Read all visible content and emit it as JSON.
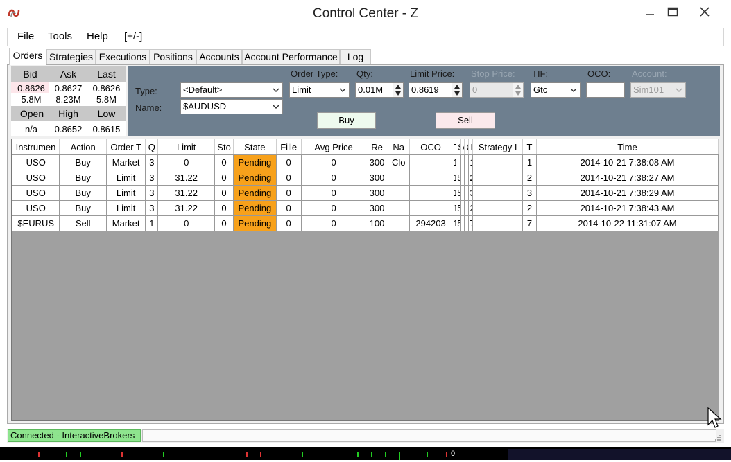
{
  "window": {
    "title": "Control Center - Z"
  },
  "menu": [
    "File",
    "Tools",
    "Help",
    "[+/-]"
  ],
  "tabs": [
    "Orders",
    "Strategies",
    "Executions",
    "Positions",
    "Accounts",
    "Account Performance",
    "Log"
  ],
  "quote": {
    "headers1": [
      "Bid",
      "Ask",
      "Last"
    ],
    "prices": [
      "0.8626",
      "0.8627",
      "0.8626"
    ],
    "sizes": [
      "5.8M",
      "8.23M",
      "5.8M"
    ],
    "headers2": [
      "Open",
      "High",
      "Low"
    ],
    "ohl": [
      "n/a",
      "0.8652",
      "0.8615"
    ]
  },
  "order_entry": {
    "type_label": "Type:",
    "type_value": "<Default>",
    "name_label": "Name:",
    "name_value": "$AUDUSD",
    "order_type_label": "Order Type:",
    "order_type_value": "Limit",
    "qty_label": "Qty:",
    "qty_value": "0.01M",
    "limit_label": "Limit Price:",
    "limit_value": "0.8619",
    "stop_label": "Stop Price:",
    "stop_value": "0",
    "tif_label": "TIF:",
    "tif_value": "Gtc",
    "oco_label": "OCO:",
    "oco_value": "",
    "account_label": "Account:",
    "account_value": "Sim101",
    "buy_label": "Buy",
    "sell_label": "Sell",
    "buy_color": "#eefaee",
    "sell_color": "#fbe9ec"
  },
  "grid": {
    "headers": [
      "Instrumen",
      "Action",
      "Order T",
      "Q",
      "Limit",
      "Sto",
      "State",
      "Fille",
      "Avg Price",
      "Re",
      "Na",
      "OCO",
      "T",
      "S",
      "A",
      "C",
      "I",
      "Strategy I",
      "T",
      "Time"
    ],
    "rows": [
      [
        "USO",
        "Buy",
        "Market",
        "3",
        "0",
        "0",
        "Pending",
        "0",
        "0",
        "300",
        "Clo",
        "",
        "1",
        "",
        "",
        "",
        "1",
        "",
        "1",
        "2014-10-21 7:38:08 AM"
      ],
      [
        "USO",
        "Buy",
        "Limit",
        "3",
        "31.22",
        "0",
        "Pending",
        "0",
        "0",
        "300",
        "",
        "",
        "1",
        "5",
        "",
        "",
        "2",
        "",
        "2",
        "2014-10-21 7:38:27 AM"
      ],
      [
        "USO",
        "Buy",
        "Limit",
        "3",
        "31.22",
        "0",
        "Pending",
        "0",
        "0",
        "300",
        "",
        "",
        "1",
        "5",
        "",
        "",
        "3",
        "",
        "3",
        "2014-10-21 7:38:29 AM"
      ],
      [
        "USO",
        "Buy",
        "Limit",
        "3",
        "31.22",
        "0",
        "Pending",
        "0",
        "0",
        "300",
        "",
        "",
        "1",
        "5",
        "",
        "",
        "2",
        "",
        "2",
        "2014-10-21 7:38:43 AM"
      ],
      [
        "$EURUS",
        "Sell",
        "Market",
        "1",
        "0",
        "0",
        "Pending",
        "0",
        "0",
        "100",
        "",
        "294203",
        "1",
        "5",
        "",
        "",
        "7",
        "",
        "7",
        "2014-10-22 11:31:07 AM"
      ]
    ],
    "pending_color": "#f7a11b"
  },
  "status": {
    "connection": "Connected - InteractiveBrokers",
    "connection_color": "#8ee48e"
  },
  "taskbar": {
    "readout": "0"
  }
}
